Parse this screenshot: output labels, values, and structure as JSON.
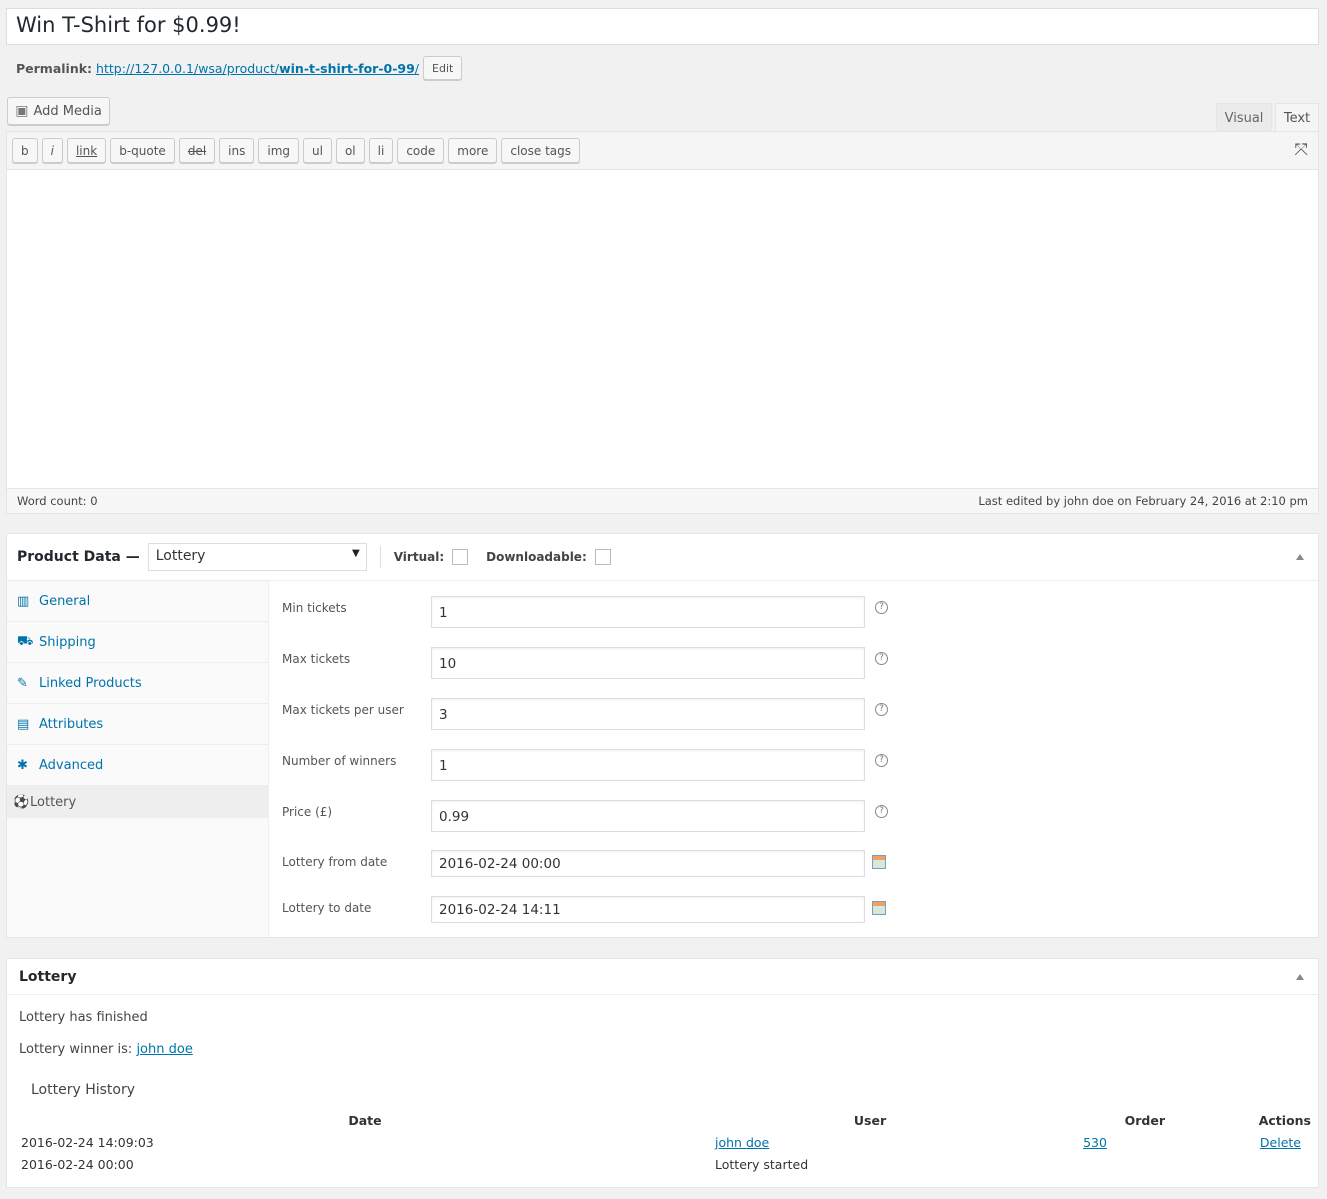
{
  "title": "Win T-Shirt for $0.99!",
  "permalink": {
    "label": "Permalink:",
    "url_base": "http://127.0.0.1/wsa/product/",
    "slug": "win-t-shirt-for-0-99",
    "url_end": "/",
    "edit": "Edit"
  },
  "editor": {
    "add_media": "Add Media",
    "tabs": [
      "Visual",
      "Text"
    ],
    "active_tab": "Text",
    "buttons": [
      "b",
      "i",
      "link",
      "b-quote",
      "del",
      "ins",
      "img",
      "ul",
      "ol",
      "li",
      "code",
      "more",
      "close tags"
    ],
    "word_count": "Word count: 0",
    "last_edited": "Last edited by john doe on February 24, 2016 at 2:10 pm"
  },
  "product_data": {
    "label": "Product Data —",
    "type": "Lottery",
    "virtual": "Virtual:",
    "downloadable": "Downloadable:",
    "virtual_checked": false,
    "downloadable_checked": false,
    "tabs": [
      {
        "label": "General",
        "icon": "general-icon"
      },
      {
        "label": "Shipping",
        "icon": "truck-icon"
      },
      {
        "label": "Linked Products",
        "icon": "link-icon"
      },
      {
        "label": "Attributes",
        "icon": "attributes-icon"
      },
      {
        "label": "Advanced",
        "icon": "gear-icon"
      },
      {
        "label": "Lottery",
        "icon": "lottery-icon"
      }
    ],
    "active_tab": "Lottery",
    "fields": [
      {
        "label": "Min tickets",
        "value": "1",
        "icon": "help"
      },
      {
        "label": "Max tickets",
        "value": "10",
        "icon": "help"
      },
      {
        "label": "Max tickets per user",
        "value": "3",
        "icon": "help"
      },
      {
        "label": "Number of winners",
        "value": "1",
        "icon": "help"
      },
      {
        "label": "Price (£)",
        "value": "0.99",
        "icon": "help"
      },
      {
        "label": "Lottery from date",
        "value": "2016-02-24 00:00",
        "icon": "calendar"
      },
      {
        "label": "Lottery to date",
        "value": "2016-02-24 14:11",
        "icon": "calendar"
      }
    ]
  },
  "lottery": {
    "title": "Lottery",
    "status": "Lottery has finished",
    "winner_label": "Lottery winner is:",
    "winner": "john doe",
    "history_title": "Lottery History",
    "columns": [
      "Date",
      "User",
      "Order",
      "Actions"
    ],
    "rows": [
      {
        "date": "2016-02-24 14:09:03",
        "user": "john doe",
        "order": "530",
        "action": "Delete"
      },
      {
        "date": "2016-02-24 00:00",
        "user": "Lottery started",
        "order": "",
        "action": ""
      }
    ]
  },
  "colors": {
    "link": "#0073aa",
    "background": "#f1f1f1"
  }
}
